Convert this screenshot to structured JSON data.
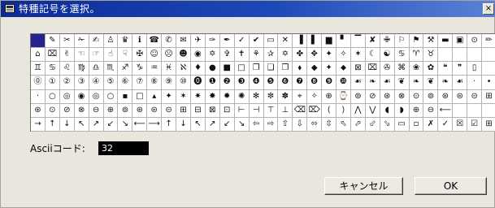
{
  "window": {
    "title": "特種記号を選択。",
    "close_label": "×"
  },
  "symbols": [
    [
      "",
      "✎",
      "✂",
      "✁",
      "✍",
      "♙",
      "♛",
      "ℹ",
      "☎",
      "✆",
      "✉",
      "✈",
      "✑",
      "✒",
      "✓",
      "✔",
      "▭",
      "✕",
      "▐",
      "▌",
      "▆",
      "▘",
      "▔",
      "✘",
      "✙",
      "⚐",
      "⚑",
      "⚒",
      "▬",
      "▣",
      "⊙",
      "✏"
    ],
    [
      "⌂",
      "⌧",
      "✌",
      "☜",
      "☞",
      "☝",
      "☟",
      "✠",
      "☺",
      "☹",
      "☻",
      "◉",
      "✡",
      "✞",
      "✝",
      "⚘",
      "✰",
      "✡",
      "✤",
      "✥",
      "✦",
      "✧",
      "✶",
      "☾",
      "☯",
      "♋",
      "♈",
      "♉"
    ],
    [
      "♊",
      "♋",
      "♌",
      "♍",
      "♎",
      "♏",
      "♐",
      "♑",
      "♒",
      "♓",
      "ℵ",
      "♦",
      "●",
      "■",
      "□",
      "❐",
      "❑",
      "❒",
      "⬧",
      "◆",
      "✦",
      "⬥",
      "⊠",
      "⌧",
      "✇",
      "⌘",
      "❀",
      "✿",
      "❝",
      "❞",
      "▯"
    ],
    [
      "⓪",
      "①",
      "②",
      "③",
      "④",
      "⑤",
      "⑥",
      "⑦",
      "⑧",
      "⑨",
      "⑩",
      "⓿",
      "❶",
      "❷",
      "❸",
      "❹",
      "❺",
      "❻",
      "❼",
      "❽",
      "❾",
      "❿",
      "☙",
      "❧",
      "☙",
      "❦",
      "❧",
      "❦",
      "❧",
      "☙",
      "·",
      "•"
    ],
    [
      "·",
      "○",
      "◎",
      "◉",
      "◎",
      "○",
      "▪",
      "□",
      "▴",
      "✦",
      "✶",
      "✷",
      "✸",
      "✹",
      "✺",
      "✻",
      "✼",
      "✽",
      "⌖",
      "✧",
      "⊕",
      "⌚",
      "⊚",
      "⊘",
      "⊛",
      "⊗",
      "⊙",
      "⊚",
      "⊛",
      "⊜",
      "⊝",
      "⊞"
    ],
    [
      "⊛",
      "⊙",
      "⊘",
      "⊗",
      "⊖",
      "⊕",
      "⊚",
      "⊛",
      "⊜",
      "⊝",
      "⊞",
      "⊟",
      "⊠",
      "⊡",
      "⊢",
      "⊣",
      "⊤",
      "⊥",
      "⌫",
      "⌦",
      "⟨",
      "⟩",
      "⋀",
      "⋁",
      "◖",
      "◗",
      "⊕",
      "⊖",
      "⟵"
    ],
    [
      "→",
      "↑",
      "↓",
      "↖",
      "↗",
      "↙",
      "↘",
      "⟵",
      "⟶",
      "↑",
      "↓",
      "↖",
      "↗",
      "↙",
      "↘",
      "⇦",
      "⇨",
      "⇧",
      "⇩",
      "⬄",
      "⇳",
      "⬁",
      "⬀",
      "⬃",
      "⬂",
      "▭",
      "▫",
      "✗",
      "✓",
      "☒",
      "☑",
      "⊞"
    ]
  ],
  "ascii": {
    "label": "Asciiコード:",
    "value": "32"
  },
  "buttons": {
    "cancel": "キャンセル",
    "ok": "OK"
  }
}
